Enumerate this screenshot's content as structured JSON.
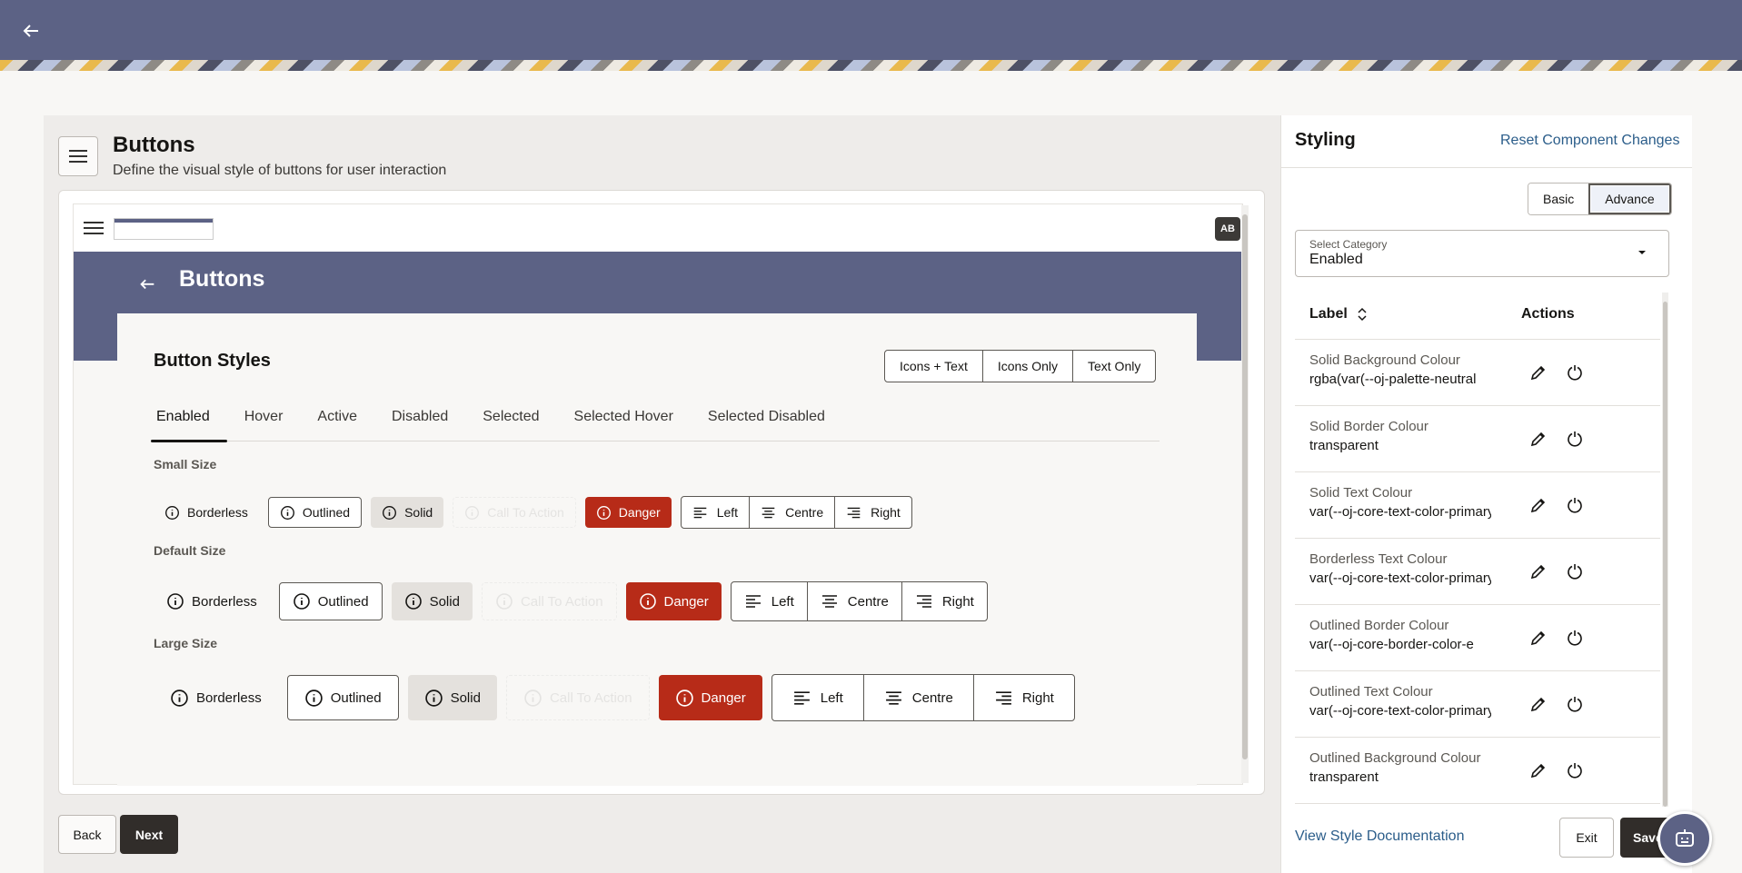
{
  "header": {
    "back_icon": "arrow-left-icon"
  },
  "page": {
    "title": "Buttons",
    "subtitle": "Define the visual style of buttons for user interaction"
  },
  "preview": {
    "avatar": "AB",
    "title": "Buttons",
    "section_title": "Button Styles",
    "display_modes": [
      "Icons + Text",
      "Icons Only",
      "Text Only"
    ],
    "tabs": [
      "Enabled",
      "Hover",
      "Active",
      "Disabled",
      "Selected",
      "Selected Hover",
      "Selected Disabled"
    ],
    "active_tab": "Enabled",
    "sizes": [
      "Small Size",
      "Default Size",
      "Large Size"
    ],
    "button_labels": {
      "borderless": "Borderless",
      "outlined": "Outlined",
      "solid": "Solid",
      "cta": "Call To Action",
      "danger": "Danger",
      "left": "Left",
      "centre": "Centre",
      "right": "Right"
    }
  },
  "footer": {
    "back": "Back",
    "next": "Next"
  },
  "styling": {
    "title": "Styling",
    "reset_link": "Reset Component Changes",
    "mode_toggle": [
      "Basic",
      "Advance"
    ],
    "selected_mode": "Advance",
    "category": {
      "label": "Select Category",
      "value": "Enabled"
    },
    "table": {
      "col_label": "Label",
      "col_actions": "Actions",
      "rows": [
        {
          "label": "Solid Background Colour",
          "value": "rgba(var(--oj-palette-neutral"
        },
        {
          "label": "Solid Border Colour",
          "value": "transparent"
        },
        {
          "label": "Solid Text Colour",
          "value": "var(--oj-core-text-color-primary"
        },
        {
          "label": "Borderless Text Colour",
          "value": "var(--oj-core-text-color-primary"
        },
        {
          "label": "Outlined Border Colour",
          "value": "var(--oj-core-border-color-e"
        },
        {
          "label": "Outlined Text Colour",
          "value": "var(--oj-core-text-color-primary"
        },
        {
          "label": "Outlined Background Colour",
          "value": "transparent"
        }
      ]
    },
    "doc_link": "View Style Documentation",
    "exit": "Exit",
    "save": "Save"
  },
  "colors": {
    "brand": "#5c6285",
    "danger": "#b72b18",
    "link": "#2b5d8a",
    "primary_button": "#312d2a"
  }
}
